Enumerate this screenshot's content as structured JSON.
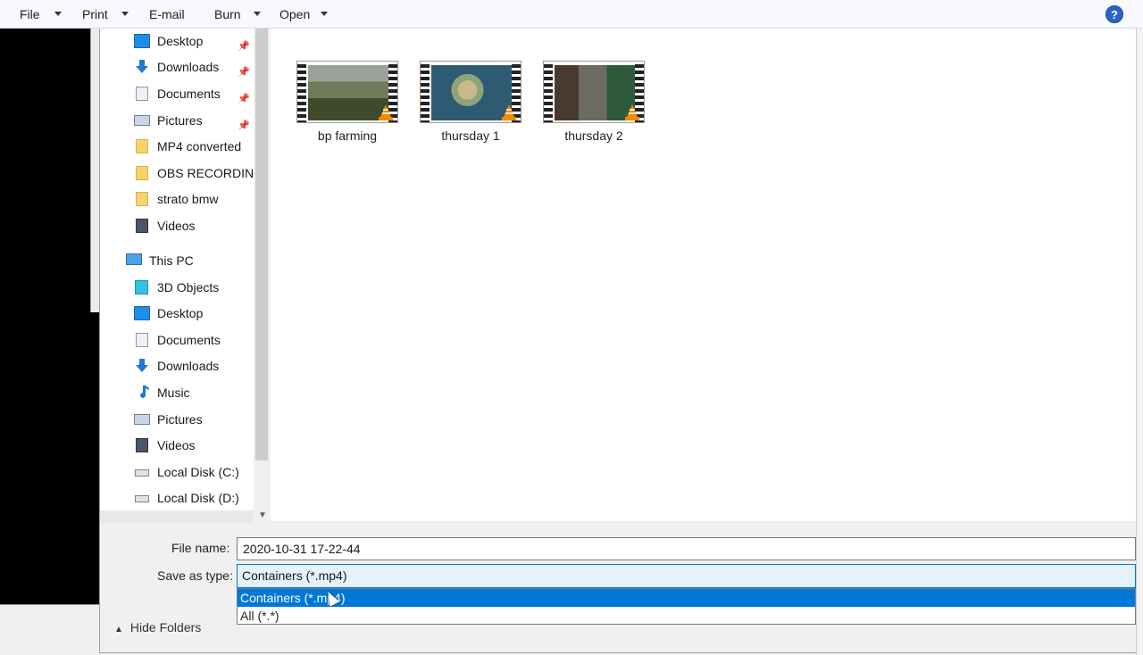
{
  "toolbar": {
    "file": "File",
    "print": "Print",
    "email": "E-mail",
    "burn": "Burn",
    "open": "Open",
    "help": "?"
  },
  "nav": {
    "quick_access": [
      {
        "label": "Desktop",
        "icon": "desktop-icon",
        "pinned": true
      },
      {
        "label": "Downloads",
        "icon": "download-icon",
        "pinned": true
      },
      {
        "label": "Documents",
        "icon": "documents-icon",
        "pinned": true
      },
      {
        "label": "Pictures",
        "icon": "pictures-icon",
        "pinned": true
      },
      {
        "label": "MP4 converted",
        "icon": "folder-icon",
        "pinned": false
      },
      {
        "label": "OBS RECORDINC",
        "icon": "folder-icon",
        "pinned": false
      },
      {
        "label": "strato bmw",
        "icon": "folder-icon",
        "pinned": false
      },
      {
        "label": "Videos",
        "icon": "videos-icon",
        "pinned": false
      }
    ],
    "this_pc": "This PC",
    "pc_items": [
      {
        "label": "3D Objects",
        "icon": "3d-objects-icon"
      },
      {
        "label": "Desktop",
        "icon": "desktop-icon"
      },
      {
        "label": "Documents",
        "icon": "documents-icon"
      },
      {
        "label": "Downloads",
        "icon": "download-icon"
      },
      {
        "label": "Music",
        "icon": "music-icon"
      },
      {
        "label": "Pictures",
        "icon": "pictures-icon"
      },
      {
        "label": "Videos",
        "icon": "videos-icon"
      },
      {
        "label": "Local Disk (C:)",
        "icon": "disk-icon"
      },
      {
        "label": "Local Disk (D:)",
        "icon": "disk-icon"
      }
    ]
  },
  "files": [
    {
      "name": "bp farming",
      "thumb_colors": [
        "#6f7a5a",
        "#3f4a2c",
        "#9aa39a"
      ]
    },
    {
      "name": "thursday 1",
      "thumb_colors": [
        "#2f5a73",
        "#8ea37a",
        "#c9b98a"
      ]
    },
    {
      "name": "thursday 2",
      "thumb_colors": [
        "#4a3a2e",
        "#6b6b62",
        "#2e5a3a"
      ]
    }
  ],
  "form": {
    "filename_label": "File name:",
    "filename_value": "2020-10-31 17-22-44",
    "type_label": "Save as type:",
    "type_value": "Containers (*.mp4)",
    "type_options": [
      "Containers (*.mp4)",
      "All (*.*)"
    ],
    "hide_folders": "Hide Folders"
  },
  "colors": {
    "accent": "#0078d7",
    "selection_bg": "#e5f1fb"
  }
}
